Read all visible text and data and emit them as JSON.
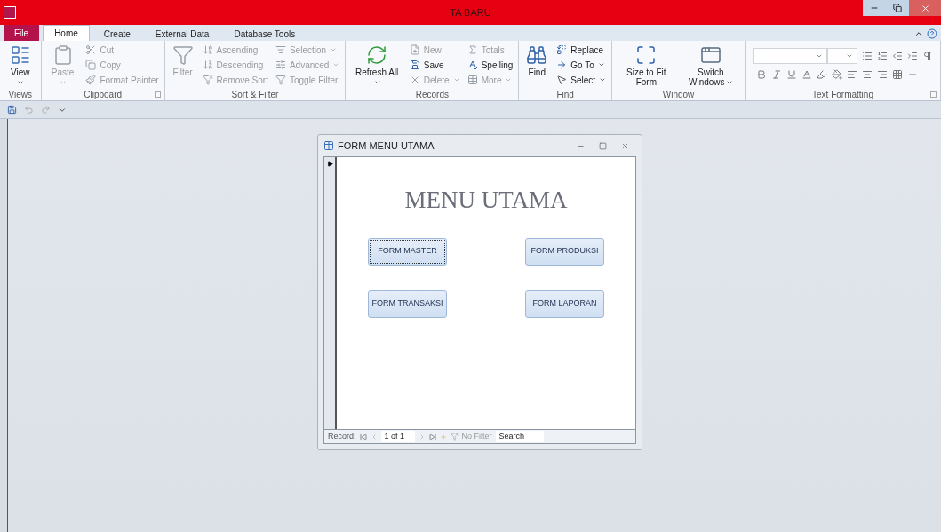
{
  "window": {
    "title": "TA BARU"
  },
  "tabs": [
    {
      "label": "File",
      "kind": "file",
      "selected": false
    },
    {
      "label": "Home",
      "kind": "tab",
      "selected": true
    },
    {
      "label": "Create",
      "kind": "tab",
      "selected": false
    },
    {
      "label": "External Data",
      "kind": "tab",
      "selected": false
    },
    {
      "label": "Database Tools",
      "kind": "tab",
      "selected": false
    }
  ],
  "ribbon": {
    "groups": [
      {
        "label": "Views",
        "kind": "items",
        "launcher": false,
        "items": [
          {
            "label": "View",
            "kind": "large",
            "disabled": false,
            "dropdown": true
          }
        ]
      },
      {
        "label": "Clipboard",
        "kind": "items",
        "launcher": true,
        "items": [
          {
            "label": "Paste",
            "kind": "large",
            "disabled": true,
            "dropdown": true
          },
          {
            "label": "Cut",
            "kind": "small",
            "disabled": true,
            "dropdown": false
          },
          {
            "label": "Copy",
            "kind": "small",
            "disabled": true,
            "dropdown": false
          },
          {
            "label": "Format Painter",
            "kind": "small",
            "disabled": true,
            "dropdown": false
          }
        ]
      },
      {
        "label": "Sort & Filter",
        "kind": "items",
        "launcher": false,
        "items": [
          {
            "label": "Filter",
            "kind": "large",
            "disabled": true,
            "dropdown": false
          },
          {
            "label": "Ascending",
            "kind": "small",
            "disabled": true,
            "dropdown": false
          },
          {
            "label": "Descending",
            "kind": "small",
            "disabled": true,
            "dropdown": false
          },
          {
            "label": "Remove Sort",
            "kind": "small",
            "disabled": true,
            "dropdown": false
          },
          {
            "label": "Selection",
            "kind": "small",
            "disabled": true,
            "dropdown": true
          },
          {
            "label": "Advanced",
            "kind": "small",
            "disabled": true,
            "dropdown": true
          },
          {
            "label": "Toggle Filter",
            "kind": "small",
            "disabled": true,
            "dropdown": false
          }
        ]
      },
      {
        "label": "Records",
        "kind": "items",
        "launcher": false,
        "items": [
          {
            "label": "Refresh All",
            "kind": "large",
            "disabled": false,
            "dropdown": true
          },
          {
            "label": "New",
            "kind": "small",
            "disabled": true,
            "dropdown": false
          },
          {
            "label": "Save",
            "kind": "small",
            "disabled": false,
            "dropdown": false
          },
          {
            "label": "Delete",
            "kind": "small",
            "disabled": true,
            "dropdown": true
          },
          {
            "label": "Totals",
            "kind": "small",
            "disabled": true,
            "dropdown": false
          },
          {
            "label": "Spelling",
            "kind": "small",
            "disabled": false,
            "dropdown": false
          },
          {
            "label": "More",
            "kind": "small",
            "disabled": true,
            "dropdown": true
          }
        ]
      },
      {
        "label": "Find",
        "kind": "items",
        "launcher": false,
        "items": [
          {
            "label": "Find",
            "kind": "large",
            "disabled": false,
            "dropdown": false
          },
          {
            "label": "Replace",
            "kind": "small",
            "disabled": false,
            "dropdown": false
          },
          {
            "label": "Go To",
            "kind": "small",
            "disabled": false,
            "dropdown": true
          },
          {
            "label": "Select",
            "kind": "small",
            "disabled": false,
            "dropdown": true
          }
        ]
      },
      {
        "label": "Window",
        "kind": "items",
        "launcher": false,
        "items": [
          {
            "label": "Size to Fit Form",
            "kind": "large",
            "disabled": false,
            "dropdown": false
          },
          {
            "label": "Switch Windows",
            "kind": "large",
            "disabled": false,
            "dropdown": true
          }
        ]
      },
      {
        "label": "Text Formatting",
        "kind": "formatting",
        "launcher": true
      }
    ]
  },
  "form": {
    "title": "FORM MENU UTAMA",
    "heading": "MENU UTAMA",
    "buttons": [
      {
        "label": "FORM MASTER",
        "focused": true
      },
      {
        "label": "FORM PRODUKSI",
        "focused": false
      },
      {
        "label": "FORM TRANSAKSI",
        "focused": false
      },
      {
        "label": "FORM LAPORAN",
        "focused": false
      }
    ],
    "navigation": {
      "label": "Record:",
      "position": "1 of 1",
      "filter": "No Filter",
      "search_placeholder": "Search"
    }
  }
}
